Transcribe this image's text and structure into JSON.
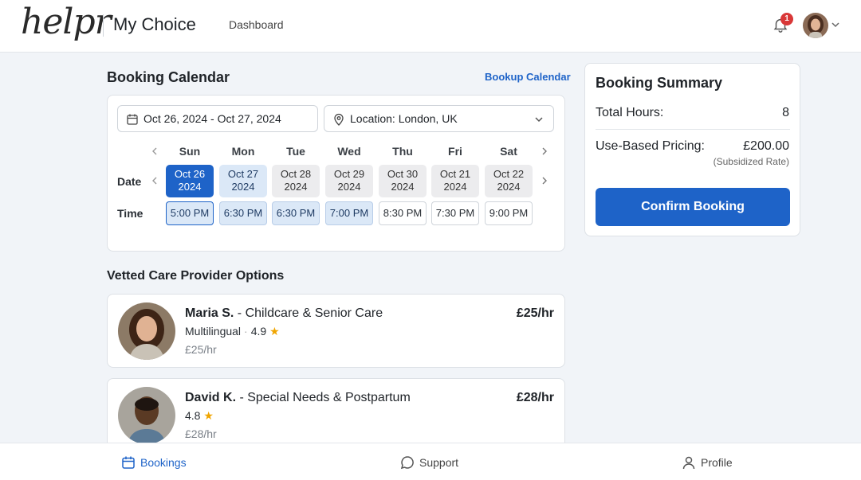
{
  "header": {
    "logo": "helpr",
    "app_title": "My Choice",
    "nav_dashboard": "Dashboard",
    "notification_count": "1"
  },
  "calendar": {
    "title": "Booking Calendar",
    "bookup_link": "Bookup Calendar",
    "date_range": "Oct 26, 2024 - Oct 27, 2024",
    "location": "Location: London, UK",
    "date_label": "Date",
    "time_label": "Time",
    "days": [
      {
        "name": "Sun",
        "date": "Oct 26",
        "year": "2024",
        "time": "5:00 PM"
      },
      {
        "name": "Mon",
        "date": "Oct 27",
        "year": "2024",
        "time": "6:30 PM"
      },
      {
        "name": "Tue",
        "date": "Oct 28",
        "year": "2024",
        "time": "6:30 PM"
      },
      {
        "name": "Wed",
        "date": "Oct 29",
        "year": "2024",
        "time": "7:00 PM"
      },
      {
        "name": "Thu",
        "date": "Oct 30",
        "year": "2024",
        "time": "8:30 PM"
      },
      {
        "name": "Fri",
        "date": "Oct 21",
        "year": "2024",
        "time": "7:30 PM"
      },
      {
        "name": "Sat",
        "date": "Oct 22",
        "year": "2024",
        "time": "9:00 PM"
      }
    ]
  },
  "providers": {
    "title": "Vetted Care Provider Options",
    "items": [
      {
        "name": "Maria S.",
        "role": " - Childcare & Senior Care",
        "tag": "Multilingual",
        "rating": "4.9",
        "rate": "£25/hr",
        "rate_small": "£25/hr"
      },
      {
        "name": "David K.",
        "role": " - Special Needs & Postpartum",
        "rating": "4.8",
        "rate": "£28/hr",
        "rate_small": "£28/hr"
      }
    ]
  },
  "summary": {
    "title": "Booking Summary",
    "hours_label": "Total Hours:",
    "hours_value": "8",
    "pricing_label": "Use-Based Pricing:",
    "pricing_value": "£200.00",
    "pricing_note": "(Subsidized Rate)",
    "confirm_label": "Confirm Booking"
  },
  "bottom_nav": {
    "bookings": "Bookings",
    "support": "Support",
    "profile": "Profile"
  },
  "colors": {
    "accent": "#1e63c8",
    "light_accent": "#dbe8f7",
    "badge": "#d93838",
    "star": "#f0a500"
  }
}
